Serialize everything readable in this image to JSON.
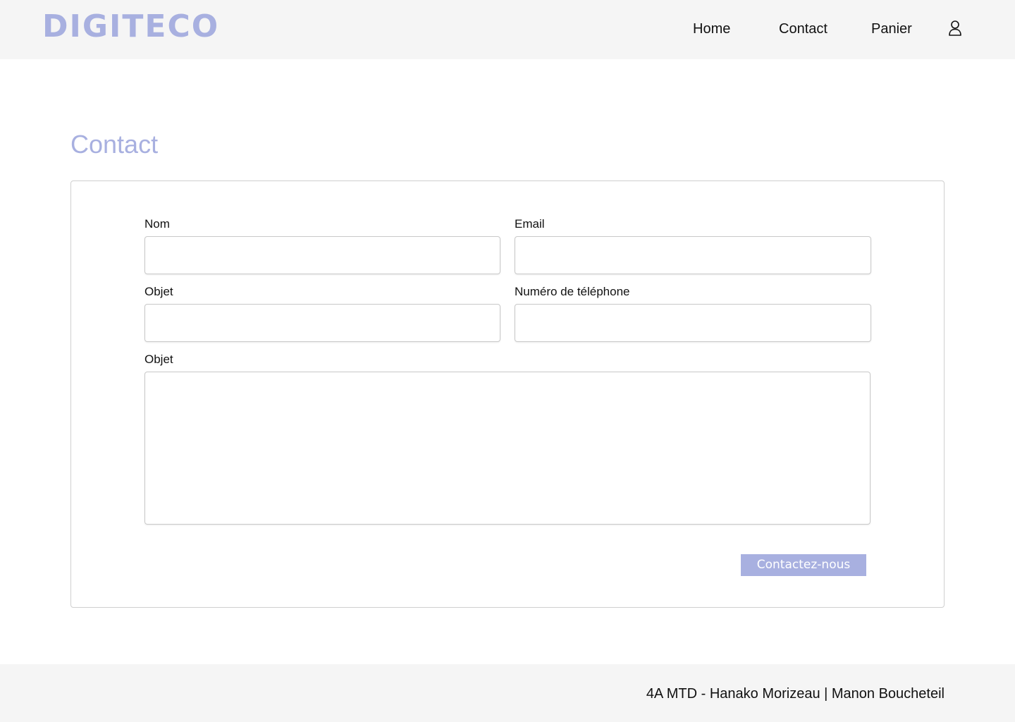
{
  "header": {
    "logo": "DIGITECO",
    "nav": {
      "home": "Home",
      "contact": "Contact",
      "panier": "Panier"
    },
    "user_icon": "user-icon"
  },
  "main": {
    "title": "Contact",
    "form": {
      "nom": {
        "label": "Nom",
        "value": "",
        "placeholder": ""
      },
      "email": {
        "label": "Email",
        "value": "",
        "placeholder": ""
      },
      "objet": {
        "label": "Objet",
        "value": "",
        "placeholder": ""
      },
      "telephone": {
        "label": "Numéro de téléphone",
        "value": "",
        "placeholder": ""
      },
      "message": {
        "label": "Objet",
        "value": "",
        "placeholder": ""
      },
      "submit_label": "Contactez-nous"
    }
  },
  "footer": {
    "text": "4A MTD - Hanako Morizeau | Manon Boucheteil"
  },
  "colors": {
    "accent": "#a8b0e0",
    "header_bg": "#f5f5f5",
    "footer_bg": "#f5f5f5",
    "border": "#cfcfcf"
  }
}
